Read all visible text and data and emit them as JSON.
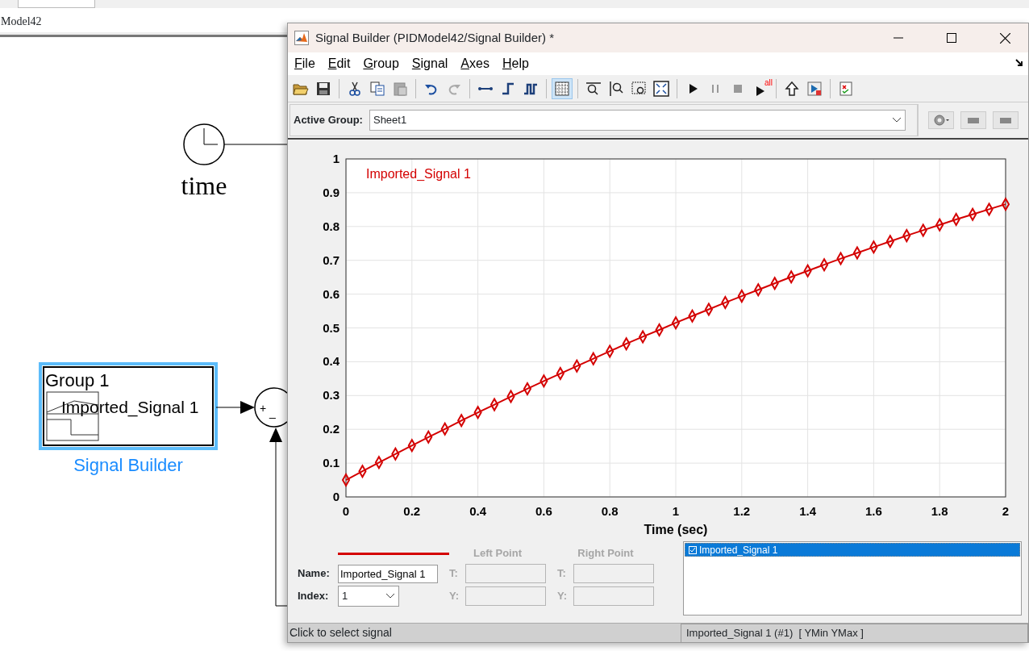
{
  "diagram": {
    "breadcrumb": "Model42",
    "clock_label": "time",
    "block": {
      "title": "Group 1",
      "signal": "Imported_Signal 1",
      "label": "Signal Builder",
      "selected": true
    },
    "sum_signs": [
      "+",
      "_"
    ]
  },
  "window": {
    "title": "Signal Builder (PIDModel42/Signal Builder) *"
  },
  "menu": [
    {
      "label": "File"
    },
    {
      "label": "Edit"
    },
    {
      "label": "Group"
    },
    {
      "label": "Signal"
    },
    {
      "label": "Axes"
    },
    {
      "label": "Help"
    }
  ],
  "toolbar": {
    "grid_selected": true,
    "play_all_badge": "all"
  },
  "active_group": {
    "label": "Active Group:",
    "value": "Sheet1"
  },
  "plot": {
    "chart_data": {
      "type": "line",
      "xlabel": "Time (sec)",
      "x": [
        0,
        0.05,
        0.1,
        0.15,
        0.2,
        0.25,
        0.3,
        0.35,
        0.4,
        0.45,
        0.5,
        0.55,
        0.6,
        0.65,
        0.7,
        0.75,
        0.8,
        0.85,
        0.9,
        0.95,
        1,
        1.05,
        1.1,
        1.15,
        1.2,
        1.25,
        1.3,
        1.35,
        1.4,
        1.45,
        1.5,
        1.55,
        1.6,
        1.65,
        1.7,
        1.75,
        1.8,
        1.85,
        1.9,
        1.95,
        2
      ],
      "grid": true,
      "series": [
        {
          "name": "Imported_Signal 1",
          "color": "#d40000",
          "marker": "diamond",
          "values": [
            0.05,
            0.076,
            0.102,
            0.127,
            0.152,
            0.177,
            0.201,
            0.226,
            0.25,
            0.273,
            0.297,
            0.32,
            0.343,
            0.365,
            0.387,
            0.409,
            0.431,
            0.453,
            0.474,
            0.494,
            0.515,
            0.535,
            0.555,
            0.575,
            0.594,
            0.613,
            0.632,
            0.651,
            0.669,
            0.687,
            0.705,
            0.722,
            0.739,
            0.756,
            0.773,
            0.789,
            0.805,
            0.821,
            0.836,
            0.851,
            0.866
          ]
        }
      ],
      "xlim": [
        0,
        2
      ],
      "ylim": [
        0,
        1
      ],
      "xticks": [
        0,
        0.2,
        0.4,
        0.6,
        0.8,
        1,
        1.2,
        1.4,
        1.6,
        1.8,
        2
      ],
      "yticks": [
        0,
        0.1,
        0.2,
        0.3,
        0.4,
        0.5,
        0.6,
        0.7,
        0.8,
        0.9,
        1
      ]
    }
  },
  "signal_panel": {
    "name_label": "Name:",
    "name_value": "Imported_Signal 1",
    "index_label": "Index:",
    "index_value": "1",
    "points": [
      {
        "title": "Left Point",
        "fields": [
          {
            "label": "T:"
          },
          {
            "label": "Y:"
          }
        ]
      },
      {
        "title": "Right Point",
        "fields": [
          {
            "label": "T:"
          },
          {
            "label": "Y:"
          }
        ]
      }
    ]
  },
  "signals": [
    {
      "label": "Imported_Signal 1",
      "checked": true,
      "selected": true
    }
  ],
  "status": {
    "message": "Click to select signal",
    "info": "Imported_Signal 1 (#1)  [ YMin YMax ]"
  }
}
